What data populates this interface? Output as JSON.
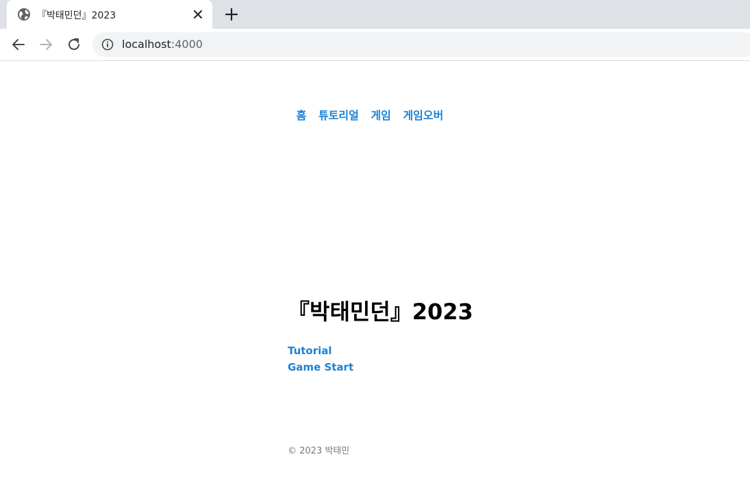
{
  "browser": {
    "tab_title": "『박태민던』2023",
    "url_host": "localhost",
    "url_port": ":4000",
    "favicon": "globe-icon"
  },
  "page": {
    "nav": [
      "홈",
      "튜토리얼",
      "게임",
      "게임오버"
    ],
    "title": "『박태민던』2023",
    "links": [
      "Tutorial",
      "Game Start"
    ],
    "footer": "© 2023 박태민"
  },
  "colors": {
    "link": "#1a82d6",
    "title": "#000000",
    "footer": "#7a7a7a",
    "chrome_bg": "#dee1e6",
    "omnibox_bg": "#f1f3f4"
  }
}
